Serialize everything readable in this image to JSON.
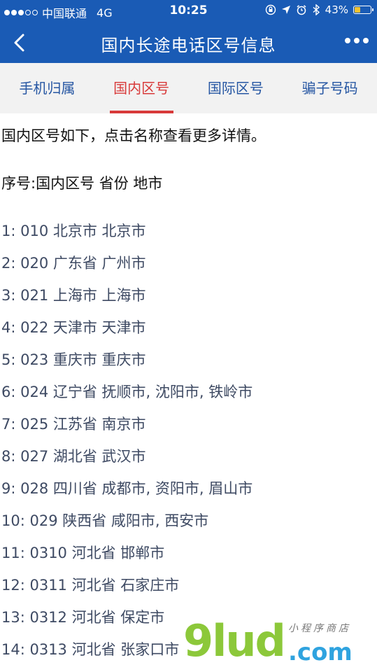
{
  "status_bar": {
    "carrier": "中国联通",
    "network": "4G",
    "time": "10:25",
    "battery": "43%",
    "battery_level": 0.43,
    "signal_full": 3,
    "signal_total": 5
  },
  "nav": {
    "title": "国内长途电话区号信息",
    "back_icon": "chevron-left-icon",
    "more_icon": "more-dots-icon"
  },
  "tabs": [
    {
      "label": "手机归属",
      "active": false
    },
    {
      "label": "国内区号",
      "active": true
    },
    {
      "label": "国际区号",
      "active": false
    },
    {
      "label": "骗子号码",
      "active": false
    }
  ],
  "content": {
    "intro": "国内区号如下，点击名称查看更多详情。",
    "header": "序号:国内区号 省份 地市",
    "items": [
      "1: 010 北京市 北京市",
      "2: 020 广东省 广州市",
      "3: 021 上海市 上海市",
      "4: 022 天津市 天津市",
      "5: 023 重庆市 重庆市",
      "6: 024 辽宁省 抚顺市, 沈阳市, 铁岭市",
      "7: 025 江苏省 南京市",
      "8: 027 湖北省 武汉市",
      "9: 028 四川省 成都市, 资阳市, 眉山市",
      "10: 029 陕西省 咸阳市, 西安市",
      "11: 0310 河北省 邯郸市",
      "12: 0311 河北省 石家庄市",
      "13: 0312 河北省 保定市",
      "14: 0313 河北省 张家口市"
    ]
  },
  "watermark": {
    "main": "9lud",
    "domain": ".com",
    "sub": "小程序商店"
  },
  "colors": {
    "brand": "#1a5bb5",
    "active_tab": "#d83a3a",
    "tab_text": "#2757a3"
  }
}
